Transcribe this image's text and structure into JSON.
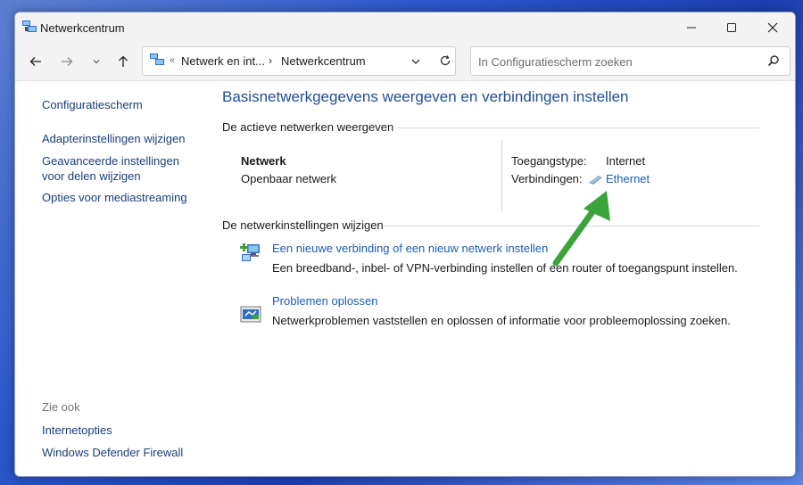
{
  "window": {
    "title": "Netwerkcentrum"
  },
  "address": {
    "overflow": "«",
    "crumbs": [
      "Netwerk en int...",
      "Netwerkcentrum"
    ]
  },
  "search": {
    "placeholder": "In Configuratiescherm zoeken"
  },
  "sidebar": {
    "home": "Configuratiescherm",
    "items": [
      {
        "label": "Adapterinstellingen wijzigen"
      },
      {
        "label": "Geavanceerde instellingen voor delen wijzigen"
      },
      {
        "label": "Opties voor mediastreaming"
      }
    ],
    "see_also_heading": "Zie ook",
    "see_also": [
      {
        "label": "Internetopties"
      },
      {
        "label": "Windows Defender Firewall"
      }
    ]
  },
  "main": {
    "title": "Basisnetwerkgegevens weergeven en verbindingen instellen",
    "active_heading": "De actieve netwerken weergeven",
    "network": {
      "name": "Netwerk",
      "type": "Openbaar netwerk",
      "access_label": "Toegangstype:",
      "access_value": "Internet",
      "connections_label": "Verbindingen:",
      "connection_link": "Ethernet"
    },
    "change_heading": "De netwerkinstellingen wijzigen",
    "actions": [
      {
        "link": "Een nieuwe verbinding of een nieuw netwerk instellen",
        "description": "Een breedband-, inbel- of VPN-verbinding instellen of een router of toegangspunt instellen."
      },
      {
        "link": "Problemen oplossen",
        "description": "Netwerkproblemen vaststellen en oplossen of informatie voor probleemoplossing zoeken."
      }
    ]
  },
  "colors": {
    "link": "#1a5fb4",
    "title": "#1f4e96",
    "arrow": "#3aa33a"
  }
}
